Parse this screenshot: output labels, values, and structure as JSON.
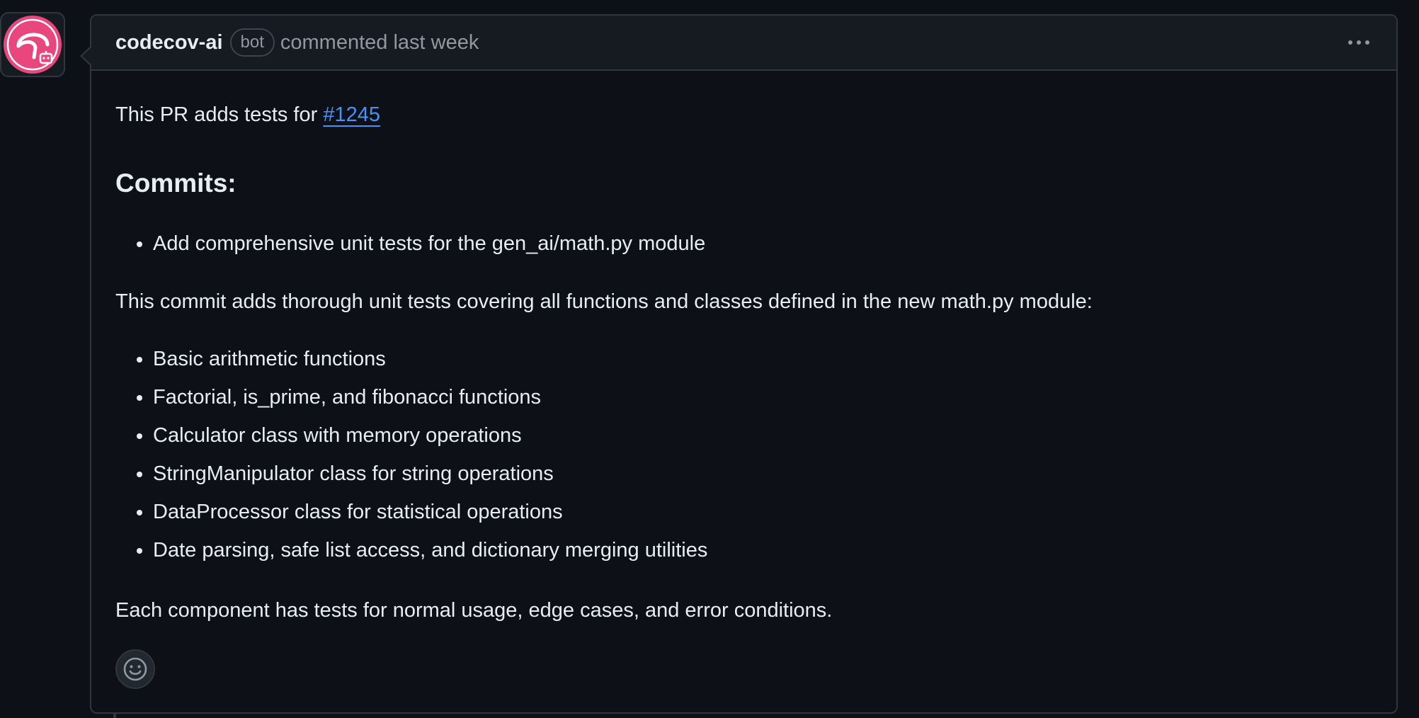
{
  "comment": {
    "author": "codecov-ai",
    "badge": "bot",
    "action_text": "commented last week",
    "more_actions_icon": "kebab-horizontal-icon",
    "intro_prefix": "This PR adds tests for ",
    "intro_link": "#1245",
    "heading": "Commits:",
    "commit_items": [
      "Add comprehensive unit tests for the gen_ai/math.py module"
    ],
    "description": "This commit adds thorough unit tests covering all functions and classes defined in the new math.py module:",
    "feature_items": [
      "Basic arithmetic functions",
      "Factorial, is_prime, and fibonacci functions",
      "Calculator class with memory operations",
      "StringManipulator class for string operations",
      "DataProcessor class for statistical operations",
      "Date parsing, safe list access, and dictionary merging utilities"
    ],
    "closing": "Each component has tests for normal usage, edge cases, and error conditions.",
    "reaction_icon": "smiley-icon"
  },
  "colors": {
    "background": "#0d1117",
    "header_background": "#161b22",
    "border": "#30363d",
    "text": "#e6edf3",
    "muted_text": "#9198a1",
    "link": "#4493f8",
    "avatar_pink": "#e8467c"
  }
}
